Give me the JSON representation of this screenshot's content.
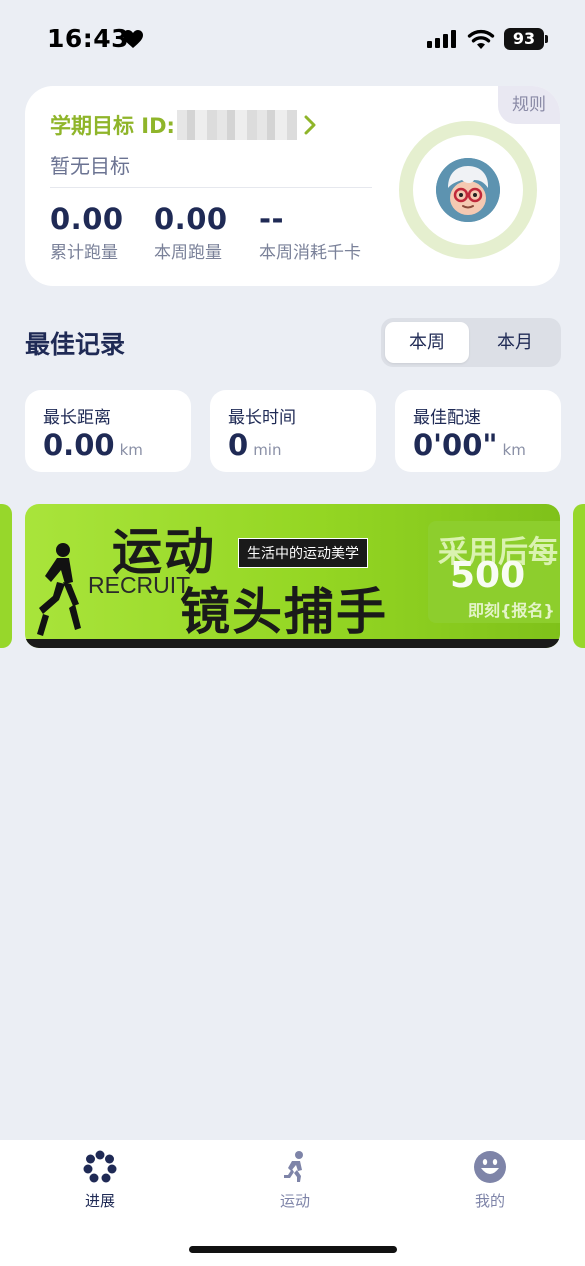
{
  "status_bar": {
    "time": "16:43",
    "battery": "93"
  },
  "goal_card": {
    "title": "学期目标 ID:",
    "no_goal": "暂无目标",
    "rules": "规则",
    "stats": [
      {
        "value": "0.00",
        "label": "累计跑量"
      },
      {
        "value": "0.00",
        "label": "本周跑量"
      },
      {
        "value": "--",
        "label": "本周消耗千卡"
      }
    ]
  },
  "best_record": {
    "title": "最佳记录",
    "toggle": {
      "week": "本周",
      "month": "本月",
      "selected": "本周"
    },
    "cards": [
      {
        "label": "最长距离",
        "value": "0.00",
        "unit": "km"
      },
      {
        "label": "最长时间",
        "value": "0",
        "unit": "min"
      },
      {
        "label": "最佳配速",
        "value": "0'00\"",
        "unit": "km"
      }
    ]
  },
  "banner": {
    "title_line1": "运动",
    "recruit": "RECRUIT",
    "title_line2": "镜头捕手",
    "subtitle": "生活中的运动美学",
    "right_line1": "采用后每",
    "right_line2": "500",
    "right_line3": "即刻{报名}"
  },
  "tabbar": {
    "items": [
      {
        "label": "进展",
        "icon": "progress-icon"
      },
      {
        "label": "运动",
        "icon": "runner-icon"
      },
      {
        "label": "我的",
        "icon": "smiley-icon"
      }
    ]
  },
  "colors": {
    "accent_green": "#8fb52a",
    "navy": "#1f2a55",
    "background": "#ebeef4"
  }
}
